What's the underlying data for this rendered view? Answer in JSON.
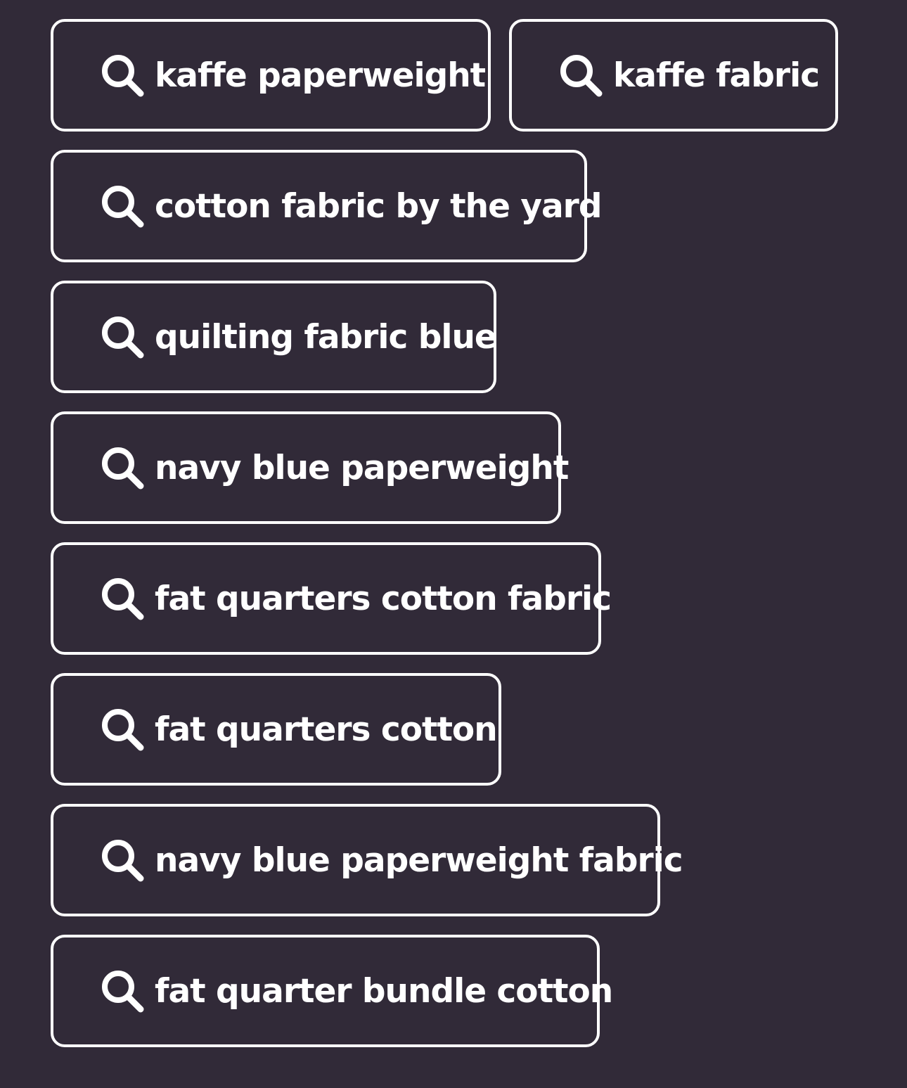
{
  "background_color": "#312a38",
  "chip_color": "#ffffff",
  "icon": "search-icon",
  "suggestions": [
    {
      "label": "kaffe paperweight"
    },
    {
      "label": "kaffe fabric"
    },
    {
      "label": "cotton fabric by the yard"
    },
    {
      "label": "quilting fabric blue"
    },
    {
      "label": "navy blue paperweight"
    },
    {
      "label": "fat quarters cotton fabric"
    },
    {
      "label": "fat quarters cotton"
    },
    {
      "label": "navy blue paperweight fabric"
    },
    {
      "label": "fat quarter bundle cotton"
    }
  ]
}
